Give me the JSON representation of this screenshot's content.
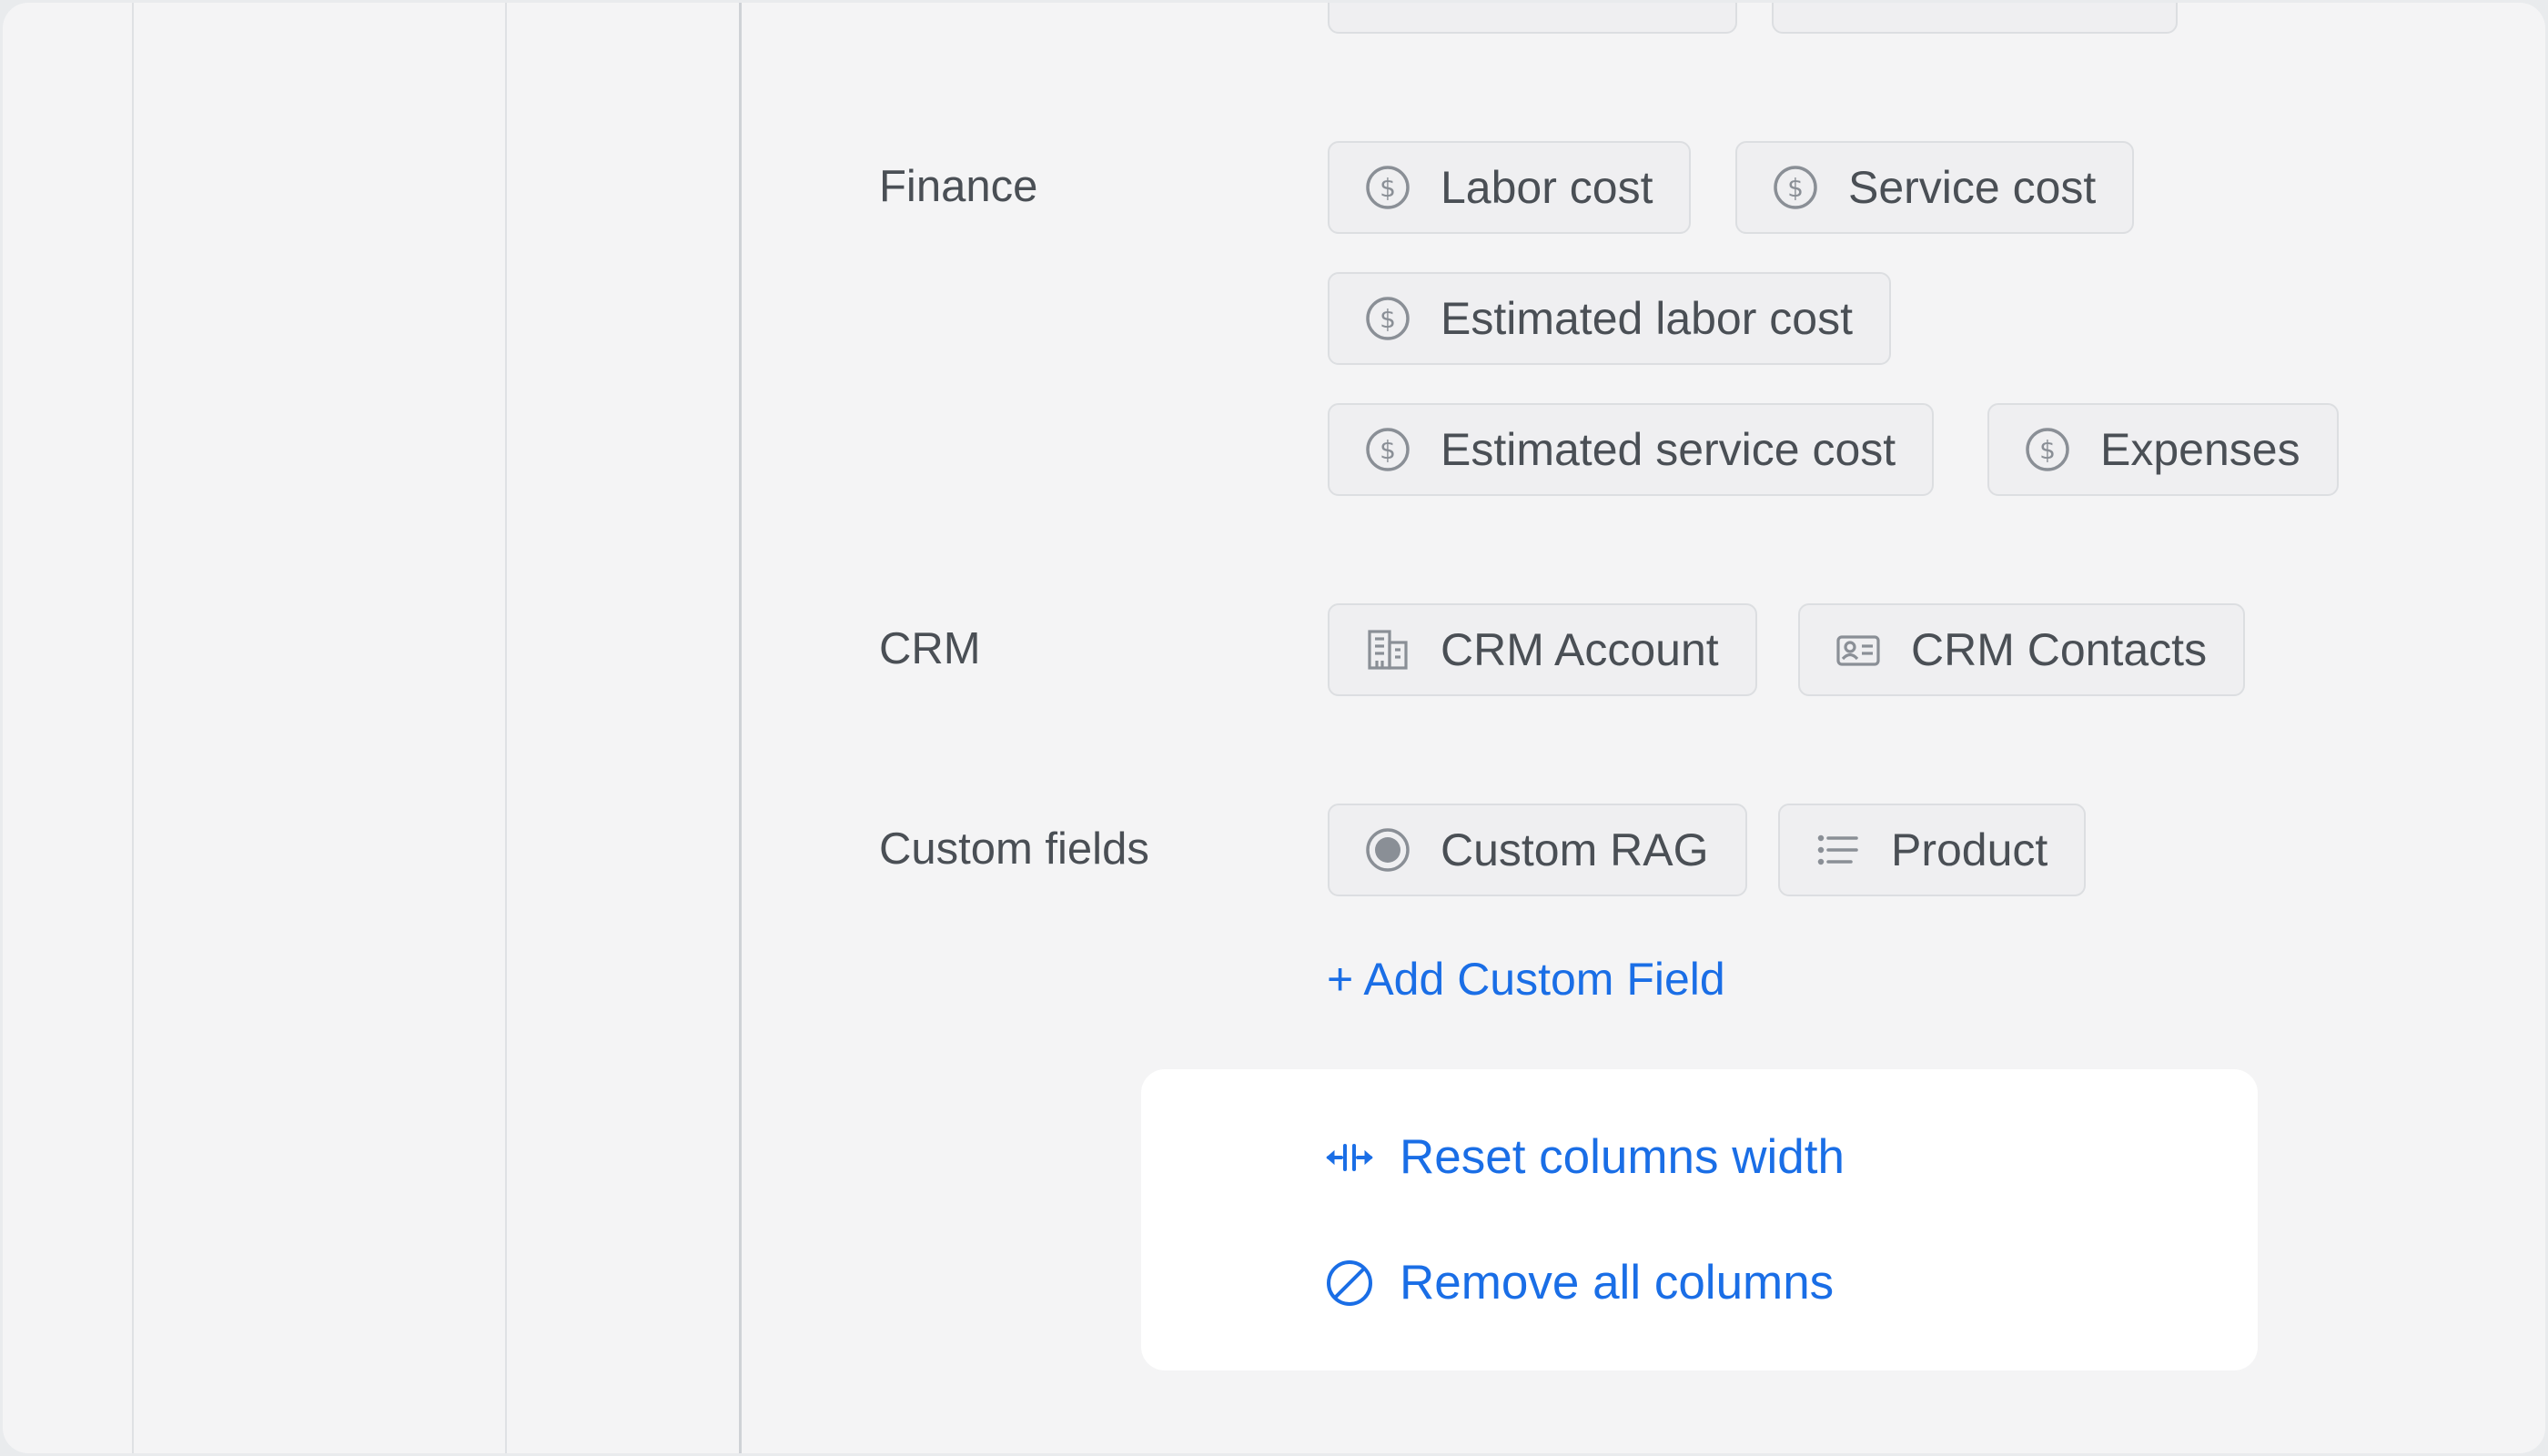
{
  "sections": {
    "finance": {
      "label": "Finance",
      "chips": [
        "Labor cost",
        "Service cost",
        "Estimated labor cost",
        "Estimated service cost",
        "Expenses"
      ]
    },
    "crm": {
      "label": "CRM",
      "chips": [
        "CRM Account",
        "CRM Contacts"
      ]
    },
    "custom_fields": {
      "label": "Custom fields",
      "chips": [
        "Custom RAG",
        "Product"
      ],
      "add_link": "+ Add Custom Field"
    }
  },
  "actions": {
    "reset": "Reset columns width",
    "remove": "Remove all columns"
  },
  "icons": {
    "finance": "dollar-circle-icon",
    "crm_account": "building-icon",
    "crm_contacts": "contact-card-icon",
    "custom_rag": "radio-dot-icon",
    "product": "list-icon",
    "reset": "column-resize-icon",
    "remove": "ban-icon"
  },
  "colors": {
    "accent": "#1a6ee6",
    "text": "#4a4f55",
    "icon": "#8a8f96"
  }
}
